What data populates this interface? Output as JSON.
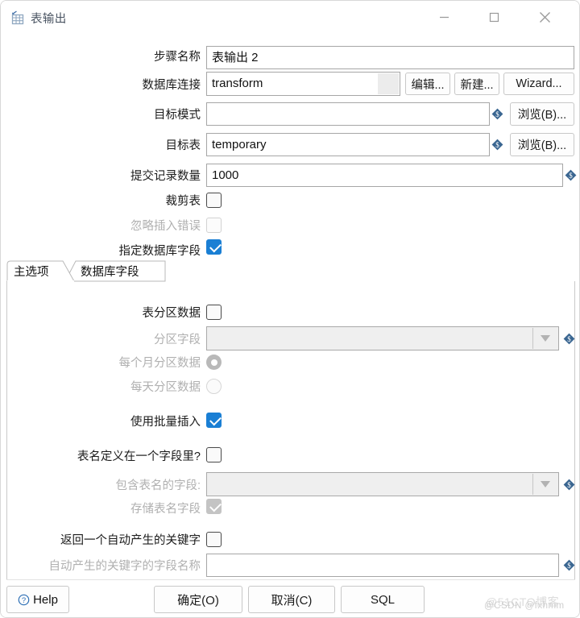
{
  "window": {
    "title": "表输出",
    "icon": "table-output-icon",
    "controls": {
      "minimize": "minimize-icon",
      "maximize": "maximize-icon",
      "close": "close-icon"
    }
  },
  "form": {
    "step_name": {
      "label": "步骤名称",
      "value": "表输出 2"
    },
    "db_connection": {
      "label": "数据库连接",
      "value": "transform",
      "edit_button": "编辑...",
      "new_button": "新建...",
      "wizard_button": "Wizard..."
    },
    "target_schema": {
      "label": "目标模式",
      "value": "",
      "browse_button": "浏览(B)..."
    },
    "target_table": {
      "label": "目标表",
      "value": "temporary",
      "browse_button": "浏览(B)..."
    },
    "commit_size": {
      "label": "提交记录数量",
      "value": "1000"
    },
    "truncate_table": {
      "label": "裁剪表",
      "checked": false,
      "enabled": true
    },
    "ignore_insert_errors": {
      "label": "忽略插入错误",
      "checked": false,
      "enabled": false
    },
    "specify_db_fields": {
      "label": "指定数据库字段",
      "checked": true,
      "enabled": true
    }
  },
  "tabs": [
    {
      "label": "主选项",
      "selected": true
    },
    {
      "label": "数据库字段",
      "selected": false
    }
  ],
  "main_options": {
    "partition_data": {
      "label": "表分区数据",
      "checked": false,
      "enabled": true
    },
    "partition_field": {
      "label": "分区字段",
      "value": "",
      "enabled": false
    },
    "partition_per_month": {
      "label": "每个月分区数据",
      "selected": true,
      "enabled": false
    },
    "partition_per_day": {
      "label": "每天分区数据",
      "selected": false,
      "enabled": false
    },
    "use_batch_insert": {
      "label": "使用批量插入",
      "checked": true,
      "enabled": true
    },
    "table_name_in_field": {
      "label": "表名定义在一个字段里?",
      "checked": false,
      "enabled": true
    },
    "field_with_table_name": {
      "label": "包含表名的字段:",
      "value": "",
      "enabled": false
    },
    "store_table_name_field": {
      "label": "存储表名字段",
      "checked": true,
      "enabled": false
    },
    "return_auto_key": {
      "label": "返回一个自动产生的关键字",
      "checked": false,
      "enabled": true
    },
    "auto_key_field_name": {
      "label": "自动产生的关键字的字段名称",
      "value": "",
      "enabled": false
    }
  },
  "footer": {
    "help": "Help",
    "ok": "确定(O)",
    "cancel": "取消(C)",
    "sql": "SQL"
  },
  "watermarks": {
    "primary": "@51CTO博客",
    "secondary": "@CSDN @fxhmm"
  },
  "colors": {
    "accent_checkbox": "#1a7fd4",
    "variable_diamond": "#3a6691",
    "help_icon": "#2d6fb5"
  }
}
